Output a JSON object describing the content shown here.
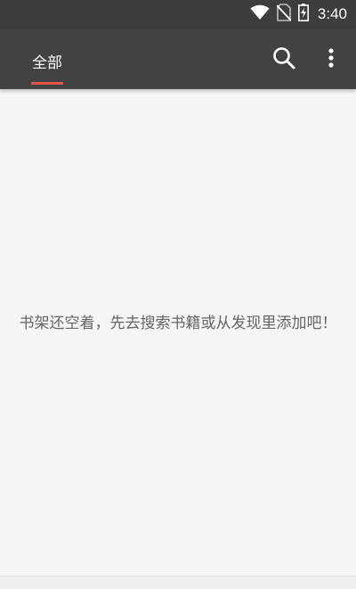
{
  "status_bar": {
    "time": "3:40",
    "icons": [
      "wifi-icon",
      "no-sim-icon",
      "battery-charging-icon"
    ]
  },
  "toolbar": {
    "tabs": [
      {
        "label": "全部",
        "selected": true
      }
    ],
    "actions": [
      "search-icon",
      "more-vert-icon"
    ],
    "accent_color": "#e0574a",
    "background_color": "#424242"
  },
  "main": {
    "empty_message": "书架还空着，先去搜索书籍或从发现里添加吧！"
  }
}
